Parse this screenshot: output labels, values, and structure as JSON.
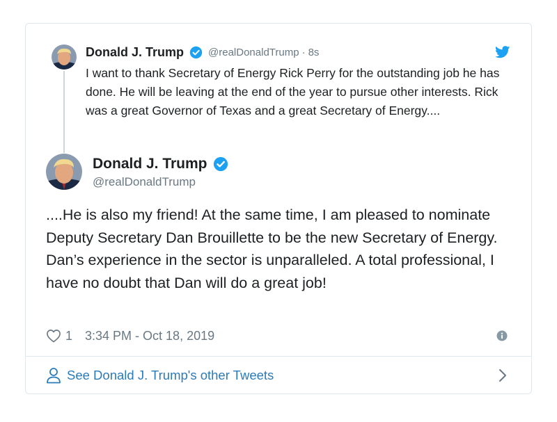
{
  "colors": {
    "verified_blue": "#1da1f2",
    "link_blue": "#2b7bb9",
    "text": "#1c2022",
    "muted": "#697882",
    "border": "#e1e8ed"
  },
  "icons": {
    "brand": "twitter-bird-icon",
    "verified": "verified-badge-icon",
    "like": "heart-icon",
    "info": "info-icon",
    "profile": "person-icon",
    "more": "chevron-right-icon"
  },
  "parent_tweet": {
    "name": "Donald J. Trump",
    "handle": "@realDonaldTrump",
    "separator": "·",
    "time": "8s",
    "text": "I want to thank Secretary of Energy Rick Perry for the outstanding job he has done. He will be leaving at the end of the year to pursue other interests. Rick was a great Governor of Texas and a great Secretary of Energy...."
  },
  "tweet": {
    "name": "Donald J. Trump",
    "handle": "@realDonaldTrump",
    "text": "....He is also my friend! At the same time, I am pleased to nominate Deputy Secretary Dan Brouillette to be the new Secretary of Energy. Dan’s experience in the sector is unparalleled. A total professional, I have no doubt that Dan will do a great job!",
    "likes": "1",
    "timestamp": "3:34 PM - Oct 18, 2019"
  },
  "footer": {
    "link_text": "See Donald J. Trump's other Tweets"
  }
}
